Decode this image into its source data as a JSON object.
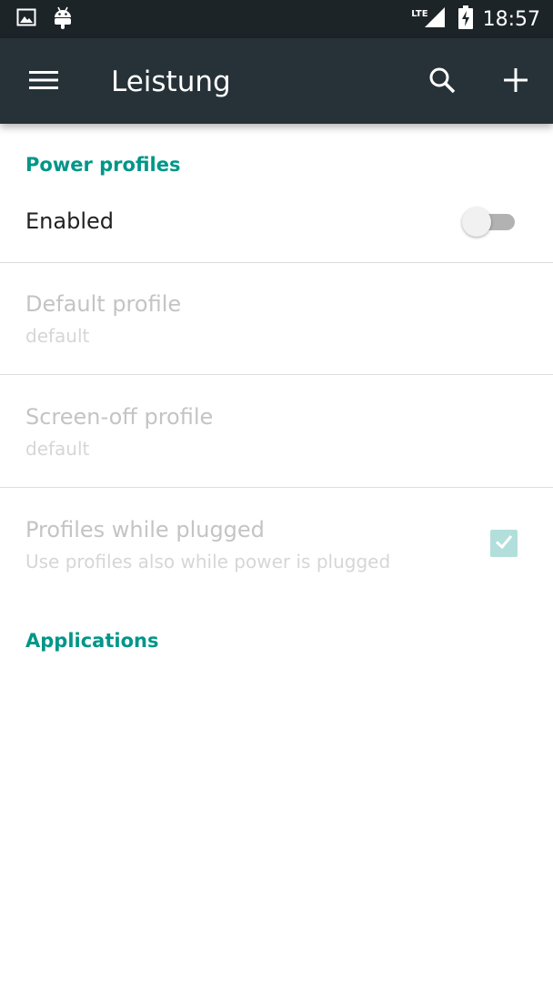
{
  "status_bar": {
    "icons_left": [
      "image-icon",
      "android-icon"
    ],
    "network": "LTE",
    "time": "18:57"
  },
  "toolbar": {
    "title": "Leistung",
    "icons": [
      "menu-icon",
      "search-icon",
      "add-icon"
    ]
  },
  "sections": {
    "power_profiles": {
      "header": "Power profiles",
      "enabled": {
        "title": "Enabled",
        "switch_on": false
      },
      "default_profile": {
        "title": "Default profile",
        "summary": "default"
      },
      "screen_off_profile": {
        "title": "Screen-off profile",
        "summary": "default"
      },
      "profiles_while_plugged": {
        "title": "Profiles while plugged",
        "summary": "Use profiles also while power is plugged",
        "checked": true
      }
    },
    "applications": {
      "header": "Applications"
    }
  },
  "colors": {
    "status_bar_bg": "#1c2428",
    "toolbar_bg": "#263238",
    "accent": "#009688",
    "disabled_checkbox": "#b2dfdb",
    "switch_track_off": "#b2b2b2"
  }
}
